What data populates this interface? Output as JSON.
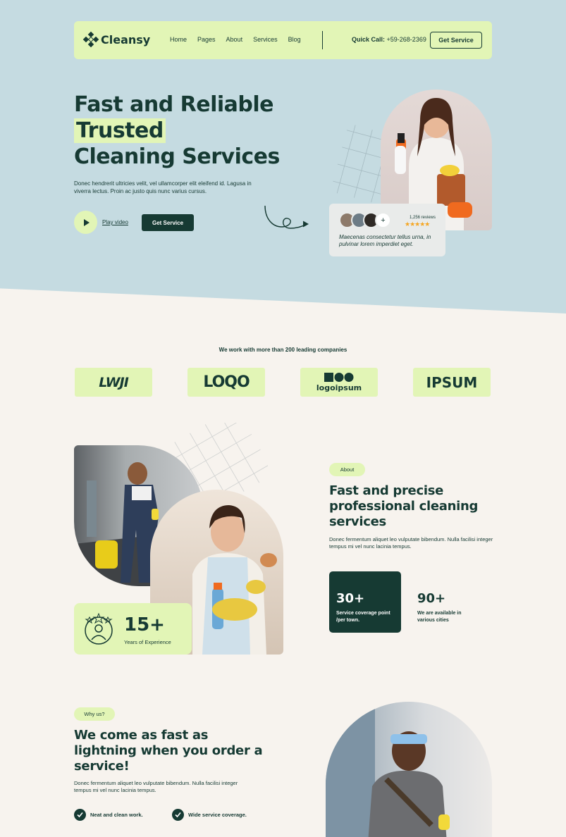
{
  "brand": {
    "name": "Cleansy"
  },
  "nav": {
    "links": [
      "Home",
      "Pages",
      "About",
      "Services",
      "Blog"
    ],
    "quick_call_label": "Quick Call:",
    "quick_call_number": "+59-268-2369",
    "cta": "Get Service"
  },
  "hero": {
    "title_line1": "Fast and Reliable",
    "title_line2": "Trusted",
    "title_line3": "Cleaning Services",
    "description": "Donec hendrerit ultricies velit, vel ullamcorper elit eleifend id. Lagusa in viverra lectus. Proin ac justo quis nunc varius cursus.",
    "play_label": "Play video",
    "cta": "Get Service",
    "review": {
      "count": "1,256 reviews",
      "stars": "★★★★★",
      "text": "Maecenas consectetur tellus urna, in pulvinar lorem imperdiet eget.",
      "plus": "+"
    }
  },
  "partners": {
    "heading": "We work with more than 200 leading companies",
    "logos": [
      "LWJI",
      "LOQO",
      "logoipsum",
      "IPSUM"
    ]
  },
  "about": {
    "badge": "About",
    "title_line1": "Fast and precise",
    "title_line2": "professional cleaning",
    "title_line3": "services",
    "description": "Donec fermentum aliquet leo vulputate bibendum. Nulla facilisi integer tempus mi vel nunc lacinia tempus.",
    "experience_value": "15+",
    "experience_label": "Years of Experience",
    "stats": [
      {
        "value": "30+",
        "label": "Service coverage point /per town."
      },
      {
        "value": "90+",
        "label": "We are available in various cities"
      }
    ]
  },
  "why": {
    "badge": "Why us?",
    "title_line1": "We come as fast as",
    "title_line2": "lightning when you order a",
    "title_line3": "service!",
    "description": "Donec fermentum aliquet leo vulputate bibendum. Nulla facilisi integer tempus mi vel nunc lacinia tempus.",
    "checks": [
      "Neat and clean work.",
      "Wide service coverage."
    ]
  },
  "colors": {
    "primary": "#163a33",
    "accent": "#e2f5b6",
    "hero_bg": "#c5dbe1",
    "page_bg": "#f7f3ee",
    "star": "#f5a623"
  }
}
